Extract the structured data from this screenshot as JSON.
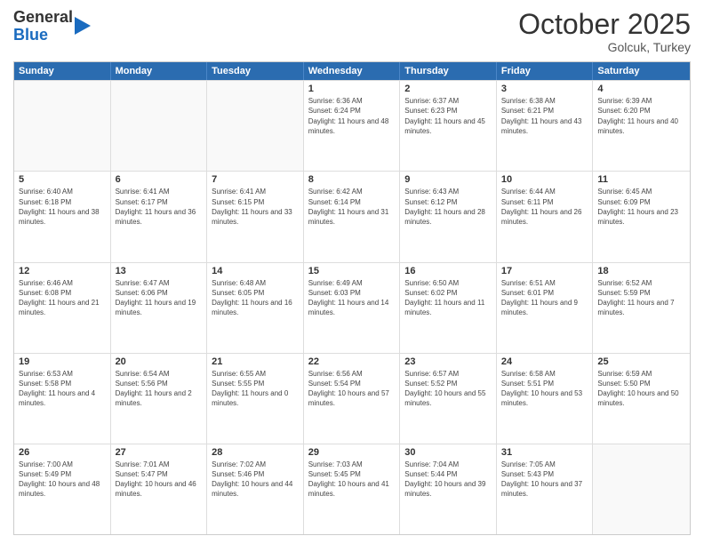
{
  "logo": {
    "general": "General",
    "blue": "Blue"
  },
  "title": "October 2025",
  "location": "Golcuk, Turkey",
  "days": [
    "Sunday",
    "Monday",
    "Tuesday",
    "Wednesday",
    "Thursday",
    "Friday",
    "Saturday"
  ],
  "rows": [
    [
      {
        "day": "",
        "text": ""
      },
      {
        "day": "",
        "text": ""
      },
      {
        "day": "",
        "text": ""
      },
      {
        "day": "1",
        "text": "Sunrise: 6:36 AM\nSunset: 6:24 PM\nDaylight: 11 hours and 48 minutes."
      },
      {
        "day": "2",
        "text": "Sunrise: 6:37 AM\nSunset: 6:23 PM\nDaylight: 11 hours and 45 minutes."
      },
      {
        "day": "3",
        "text": "Sunrise: 6:38 AM\nSunset: 6:21 PM\nDaylight: 11 hours and 43 minutes."
      },
      {
        "day": "4",
        "text": "Sunrise: 6:39 AM\nSunset: 6:20 PM\nDaylight: 11 hours and 40 minutes."
      }
    ],
    [
      {
        "day": "5",
        "text": "Sunrise: 6:40 AM\nSunset: 6:18 PM\nDaylight: 11 hours and 38 minutes."
      },
      {
        "day": "6",
        "text": "Sunrise: 6:41 AM\nSunset: 6:17 PM\nDaylight: 11 hours and 36 minutes."
      },
      {
        "day": "7",
        "text": "Sunrise: 6:41 AM\nSunset: 6:15 PM\nDaylight: 11 hours and 33 minutes."
      },
      {
        "day": "8",
        "text": "Sunrise: 6:42 AM\nSunset: 6:14 PM\nDaylight: 11 hours and 31 minutes."
      },
      {
        "day": "9",
        "text": "Sunrise: 6:43 AM\nSunset: 6:12 PM\nDaylight: 11 hours and 28 minutes."
      },
      {
        "day": "10",
        "text": "Sunrise: 6:44 AM\nSunset: 6:11 PM\nDaylight: 11 hours and 26 minutes."
      },
      {
        "day": "11",
        "text": "Sunrise: 6:45 AM\nSunset: 6:09 PM\nDaylight: 11 hours and 23 minutes."
      }
    ],
    [
      {
        "day": "12",
        "text": "Sunrise: 6:46 AM\nSunset: 6:08 PM\nDaylight: 11 hours and 21 minutes."
      },
      {
        "day": "13",
        "text": "Sunrise: 6:47 AM\nSunset: 6:06 PM\nDaylight: 11 hours and 19 minutes."
      },
      {
        "day": "14",
        "text": "Sunrise: 6:48 AM\nSunset: 6:05 PM\nDaylight: 11 hours and 16 minutes."
      },
      {
        "day": "15",
        "text": "Sunrise: 6:49 AM\nSunset: 6:03 PM\nDaylight: 11 hours and 14 minutes."
      },
      {
        "day": "16",
        "text": "Sunrise: 6:50 AM\nSunset: 6:02 PM\nDaylight: 11 hours and 11 minutes."
      },
      {
        "day": "17",
        "text": "Sunrise: 6:51 AM\nSunset: 6:01 PM\nDaylight: 11 hours and 9 minutes."
      },
      {
        "day": "18",
        "text": "Sunrise: 6:52 AM\nSunset: 5:59 PM\nDaylight: 11 hours and 7 minutes."
      }
    ],
    [
      {
        "day": "19",
        "text": "Sunrise: 6:53 AM\nSunset: 5:58 PM\nDaylight: 11 hours and 4 minutes."
      },
      {
        "day": "20",
        "text": "Sunrise: 6:54 AM\nSunset: 5:56 PM\nDaylight: 11 hours and 2 minutes."
      },
      {
        "day": "21",
        "text": "Sunrise: 6:55 AM\nSunset: 5:55 PM\nDaylight: 11 hours and 0 minutes."
      },
      {
        "day": "22",
        "text": "Sunrise: 6:56 AM\nSunset: 5:54 PM\nDaylight: 10 hours and 57 minutes."
      },
      {
        "day": "23",
        "text": "Sunrise: 6:57 AM\nSunset: 5:52 PM\nDaylight: 10 hours and 55 minutes."
      },
      {
        "day": "24",
        "text": "Sunrise: 6:58 AM\nSunset: 5:51 PM\nDaylight: 10 hours and 53 minutes."
      },
      {
        "day": "25",
        "text": "Sunrise: 6:59 AM\nSunset: 5:50 PM\nDaylight: 10 hours and 50 minutes."
      }
    ],
    [
      {
        "day": "26",
        "text": "Sunrise: 7:00 AM\nSunset: 5:49 PM\nDaylight: 10 hours and 48 minutes."
      },
      {
        "day": "27",
        "text": "Sunrise: 7:01 AM\nSunset: 5:47 PM\nDaylight: 10 hours and 46 minutes."
      },
      {
        "day": "28",
        "text": "Sunrise: 7:02 AM\nSunset: 5:46 PM\nDaylight: 10 hours and 44 minutes."
      },
      {
        "day": "29",
        "text": "Sunrise: 7:03 AM\nSunset: 5:45 PM\nDaylight: 10 hours and 41 minutes."
      },
      {
        "day": "30",
        "text": "Sunrise: 7:04 AM\nSunset: 5:44 PM\nDaylight: 10 hours and 39 minutes."
      },
      {
        "day": "31",
        "text": "Sunrise: 7:05 AM\nSunset: 5:43 PM\nDaylight: 10 hours and 37 minutes."
      },
      {
        "day": "",
        "text": ""
      }
    ]
  ]
}
